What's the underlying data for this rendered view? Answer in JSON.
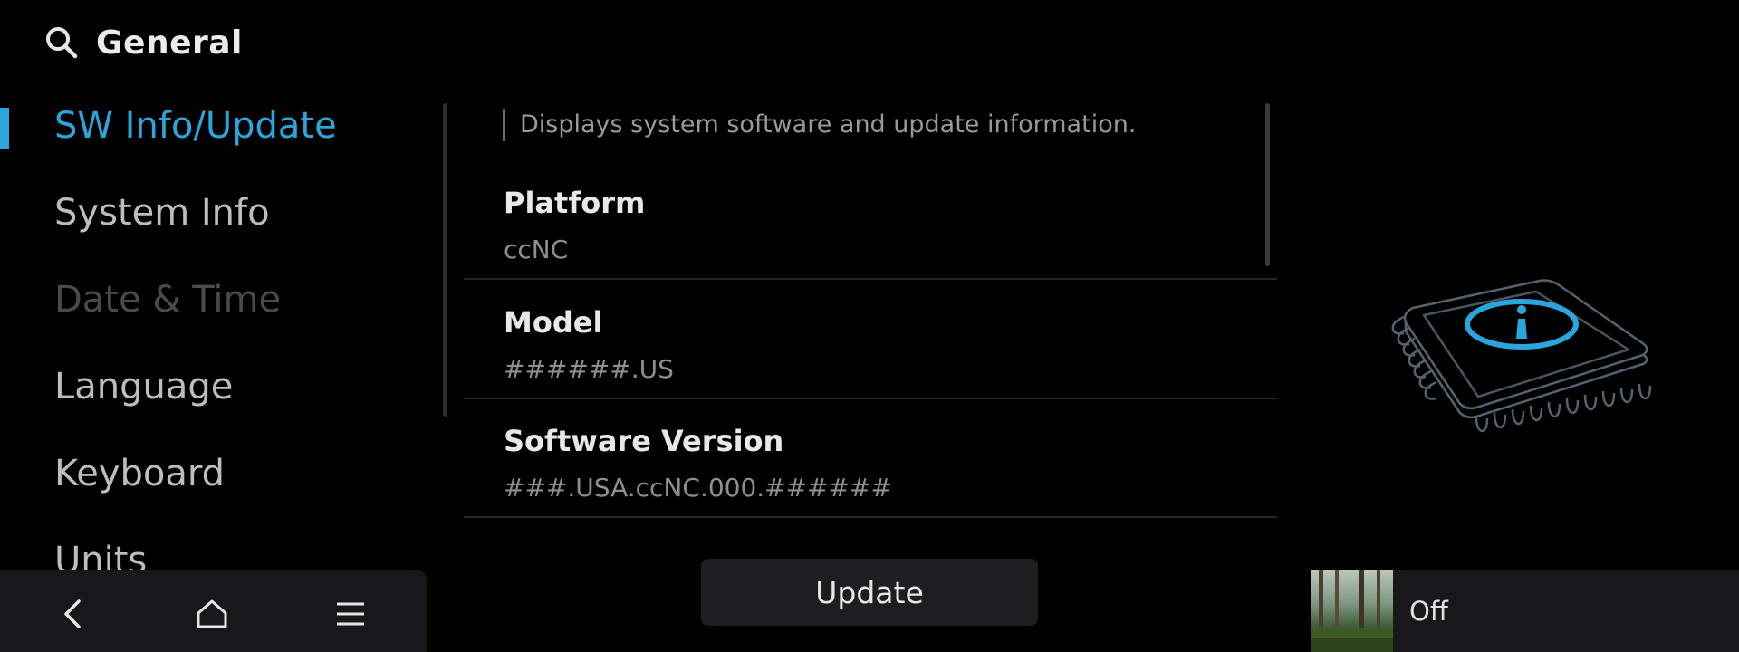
{
  "header": {
    "title": "General",
    "icon": "search-icon"
  },
  "menu": {
    "items": [
      {
        "label": "SW Info/Update",
        "state": "active"
      },
      {
        "label": "System Info",
        "state": "normal"
      },
      {
        "label": "Date & Time",
        "state": "disabled"
      },
      {
        "label": "Language",
        "state": "normal"
      },
      {
        "label": "Keyboard",
        "state": "normal"
      },
      {
        "label": "Units",
        "state": "normal"
      }
    ]
  },
  "content": {
    "description": "Displays system software and update information.",
    "rows": [
      {
        "label": "Platform",
        "value": "ccNC"
      },
      {
        "label": "Model",
        "value": "######.US"
      },
      {
        "label": "Software Version",
        "value": "###.USA.ccNC.000.######"
      }
    ],
    "update_label": "Update"
  },
  "illustration": {
    "icon": "info-chip-icon",
    "accent": "#2aa6dd"
  },
  "navbar": {
    "icons": [
      "back-icon",
      "home-icon",
      "menu-icon"
    ]
  },
  "media": {
    "status": "Off"
  },
  "colors": {
    "accent": "#2aa6dd",
    "background": "#000000",
    "panel": "#16181c"
  }
}
